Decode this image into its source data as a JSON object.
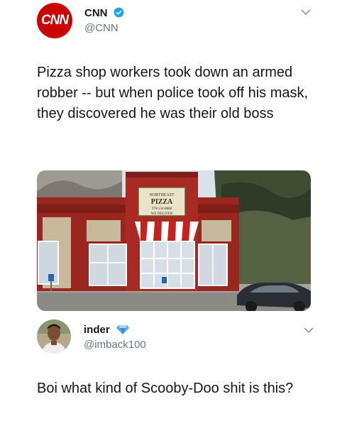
{
  "tweet": {
    "author_name": "CNN",
    "author_handle": "@CNN",
    "avatar_text": "CNN",
    "avatar_icon": "cnn-logo",
    "verified_icon": "verified-badge-icon",
    "brand_color": "#cc0000",
    "verified_color": "#1da1f2",
    "text": "Pizza shop workers took down an armed robber -- but when police took off his mask, they discovered he was their old boss",
    "menu_icon": "chevron-down-icon",
    "media": {
      "sign_line1": "NORTHEAST",
      "sign_line2": "PIZZA",
      "sign_line3": "978-534-8888",
      "sign_line4": "WE DELIVER"
    }
  },
  "reply": {
    "author_name": "inder",
    "author_handle": "@imback100",
    "badge_icon": "blue-diamond-icon",
    "badge_color": "#5dade2",
    "text": "Boi what kind of Scooby-Doo shit is this?",
    "menu_icon": "chevron-down-icon"
  },
  "colors": {
    "text": "#14171a",
    "secondary": "#657786"
  }
}
